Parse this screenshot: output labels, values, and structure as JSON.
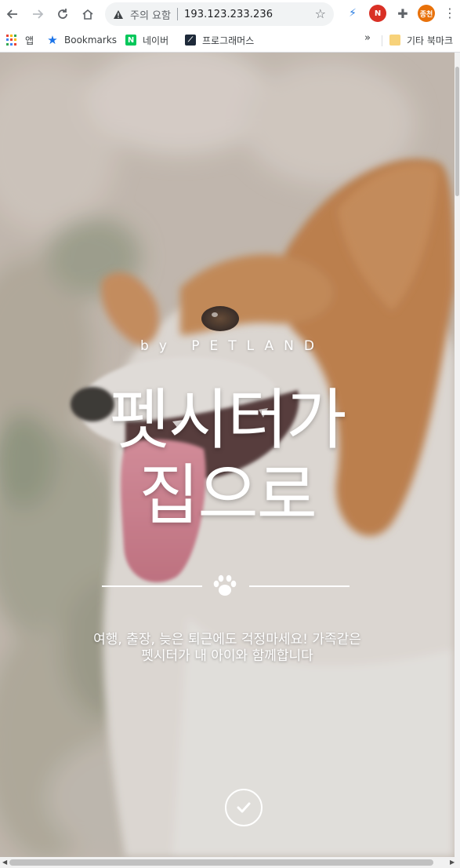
{
  "browser": {
    "security_label": "주의 요함",
    "url": "193.123.233.236",
    "profile_initials": "종천",
    "bookmarks": [
      {
        "label": "앱",
        "icon": "apps-grid-icon"
      },
      {
        "label": "Bookmarks",
        "icon": "star-icon"
      },
      {
        "label": "네이버",
        "icon": "naver-icon",
        "icon_text": "N",
        "color": "#03c75a"
      },
      {
        "label": "프로그래머스",
        "icon": "programmers-icon",
        "color": "#1e2a3a"
      }
    ],
    "overflow_label": "»",
    "other_bookmarks": "기타 북마크"
  },
  "hero": {
    "by_line": "by PETLAND",
    "title_line1": "펫시터가",
    "title_line2": "집으로",
    "subtitle_line1": "여행, 출장, 늦은 퇴근에도 걱정마세요! 가족같은",
    "subtitle_line2": "펫시터가 내 아이와 함께합니다"
  },
  "colors": {
    "hero_text": "#ffffff",
    "fur_orange": "#c97a3b",
    "background_blur": "#c9bdb0"
  }
}
